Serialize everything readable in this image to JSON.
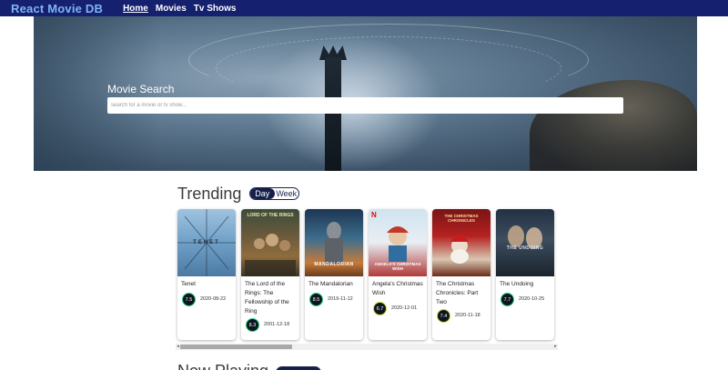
{
  "navbar": {
    "brand": "React Movie DB",
    "links": [
      {
        "label": "Home",
        "active": true
      },
      {
        "label": "Movies",
        "active": false
      },
      {
        "label": "Tv Shows",
        "active": false
      }
    ]
  },
  "hero": {
    "title": "Movie Search",
    "search_placeholder": "search for a movie or tv show...",
    "search_value": ""
  },
  "trending": {
    "title": "Trending",
    "toggle": [
      {
        "label": "Day",
        "active": true
      },
      {
        "label": "Week",
        "active": false
      }
    ],
    "cards": [
      {
        "title": "Tenet",
        "rating": "7.5",
        "date": "2020-08-22",
        "rating_color": "#21d07a",
        "poster_caption": "TENET"
      },
      {
        "title": "The Lord of the Rings: The Fellowship of the Ring",
        "rating": "8.3",
        "date": "2001-12-18",
        "rating_color": "#21d07a",
        "poster_caption": "LORD OF THE RINGS"
      },
      {
        "title": "The Mandalorian",
        "rating": "8.5",
        "date": "2019-11-12",
        "rating_color": "#21d07a",
        "poster_caption": "MANDALORIAN"
      },
      {
        "title": "Angela's Christmas Wish",
        "rating": "6.7",
        "date": "2020-12-01",
        "rating_color": "#d2d531",
        "poster_caption": "ANGELA'S CHRISTMAS WISH"
      },
      {
        "title": "The Christmas Chronicles: Part Two",
        "rating": "7.4",
        "date": "2020-11-18",
        "rating_color": "#d2d531",
        "poster_caption": "THE CHRISTMAS CHRONICLES"
      },
      {
        "title": "The Undoing",
        "rating": "7.7",
        "date": "2020-10-25",
        "rating_color": "#21d07a",
        "poster_caption": "THE UNDOING"
      }
    ]
  },
  "next_section": {
    "title": "Now Playing"
  },
  "colors": {
    "navbar_bg": "#15206e",
    "brand": "#7fb4f7",
    "toggle_active": "#14204a"
  }
}
